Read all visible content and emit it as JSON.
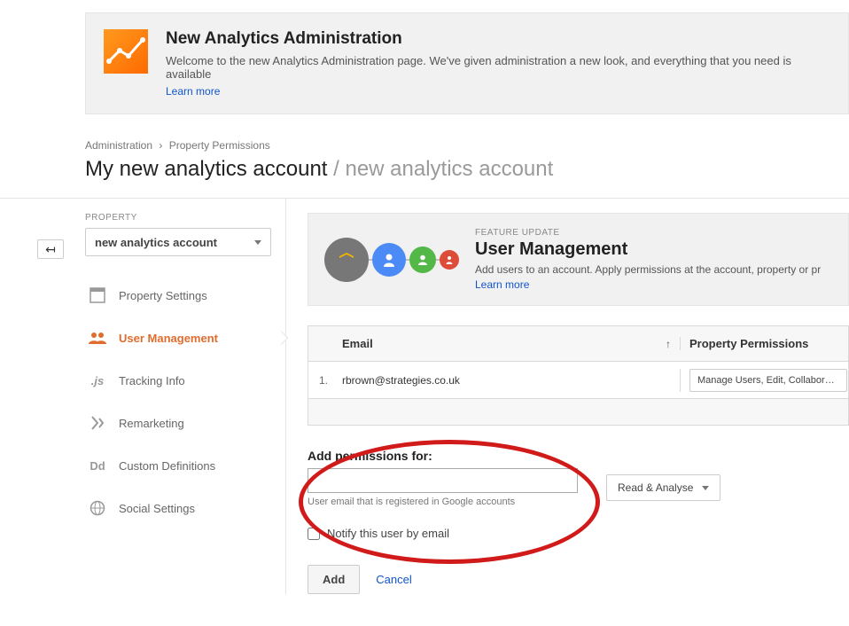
{
  "banner": {
    "title": "New Analytics Administration",
    "desc": "Welcome to the new Analytics Administration page. We've given administration a new look, and everything that you need is available",
    "learn_more": "Learn more"
  },
  "breadcrumb": {
    "root": "Administration",
    "current": "Property Permissions"
  },
  "page_title": {
    "main": "My new analytics account",
    "sub": "new analytics account"
  },
  "sidebar": {
    "label": "PROPERTY",
    "selected": "new analytics account",
    "items": [
      {
        "label": "Property Settings"
      },
      {
        "label": "User Management"
      },
      {
        "label": "Tracking Info"
      },
      {
        "label": "Remarketing"
      },
      {
        "label": "Custom Definitions"
      },
      {
        "label": "Social Settings"
      }
    ]
  },
  "feature": {
    "label": "FEATURE UPDATE",
    "title": "User Management",
    "desc": "Add users to an account. Apply permissions at the account, property or pr",
    "learn_more": "Learn more"
  },
  "table": {
    "col_email": "Email",
    "col_perm": "Property Permissions",
    "rows": [
      {
        "idx": "1.",
        "email": "rbrown@strategies.co.uk",
        "perm": "Manage Users, Edit, Collaborate, Rea"
      }
    ]
  },
  "add": {
    "title": "Add permissions for:",
    "hint": "User email that is registered in Google accounts",
    "perm_selected": "Read & Analyse",
    "notify_label": "Notify this user by email",
    "add_btn": "Add",
    "cancel": "Cancel"
  }
}
